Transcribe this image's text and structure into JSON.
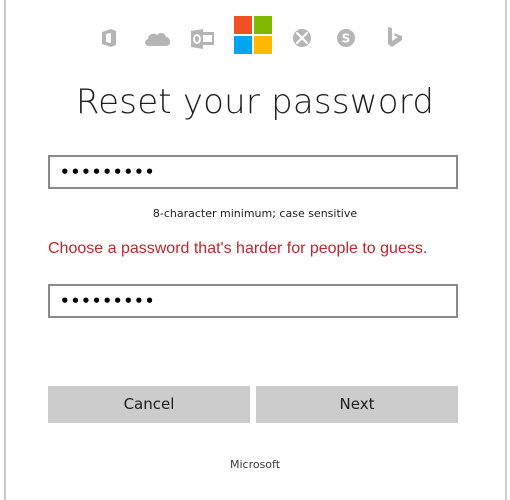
{
  "header": {
    "icons": [
      "office-icon",
      "onedrive-icon",
      "outlook-icon",
      "microsoft-logo",
      "xbox-icon",
      "skype-icon",
      "bing-icon"
    ],
    "logo_colors": [
      "#f25022",
      "#7fba00",
      "#00a4ef",
      "#ffb900"
    ],
    "icon_color": "#b5b5b5"
  },
  "page": {
    "title": "Reset your password"
  },
  "form": {
    "new_password_value": "•••••••••",
    "hint": "8-character minimum; case sensitive",
    "error": "Choose a password that's harder for people to guess.",
    "confirm_password_value": "•••••••••",
    "error_color": "#c1272d"
  },
  "actions": {
    "cancel_label": "Cancel",
    "next_label": "Next"
  },
  "footer": {
    "brand": "Microsoft"
  }
}
